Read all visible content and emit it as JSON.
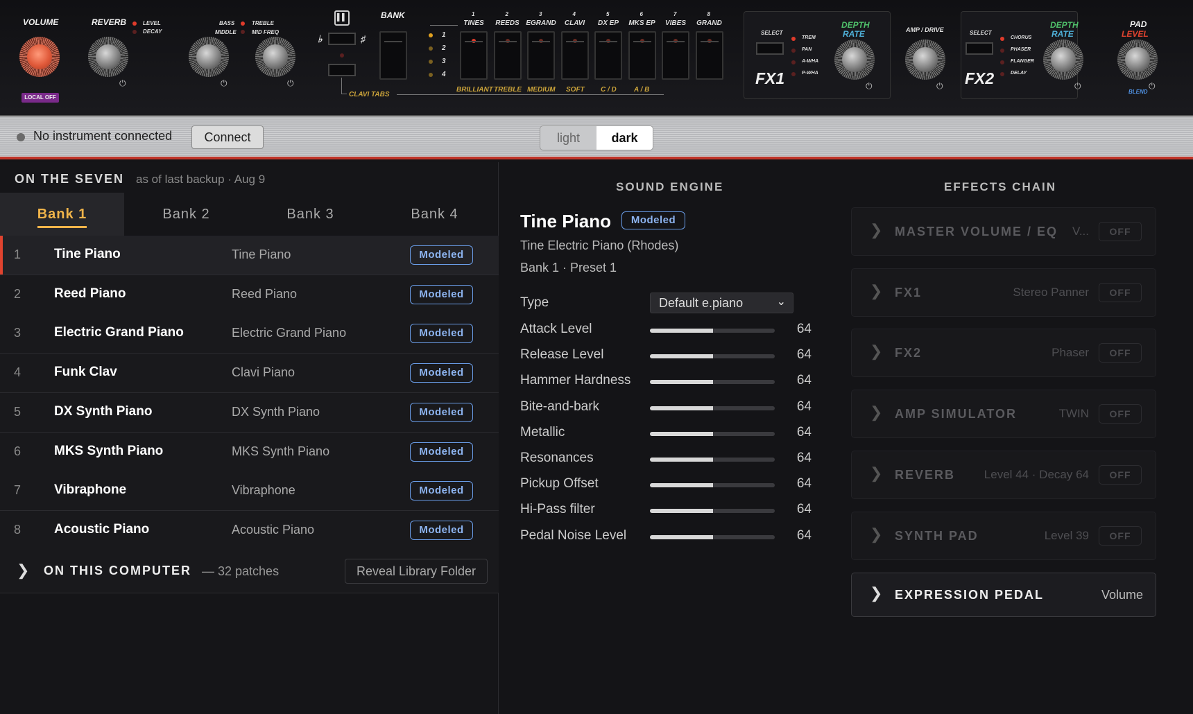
{
  "hardware": {
    "volume": "VOLUME",
    "local_off": "LOCAL OFF",
    "reverb": "REVERB",
    "reverb_level": "LEVEL",
    "reverb_decay": "DECAY",
    "bass": "BASS",
    "middle": "MIDDLE",
    "treble": "TREBLE",
    "mid_freq": "MID FREQ",
    "flat": "♭",
    "sharp": "♯",
    "bank": "BANK",
    "bank_numbers": [
      "1",
      "2",
      "3",
      "4"
    ],
    "clavi_tabs": "CLAVI TABS",
    "sound_slots": [
      {
        "num": "1",
        "label": "TINES"
      },
      {
        "num": "2",
        "label": "REEDS"
      },
      {
        "num": "3",
        "label": "EGRAND"
      },
      {
        "num": "4",
        "label": "CLAVI"
      },
      {
        "num": "5",
        "label": "DX EP"
      },
      {
        "num": "6",
        "label": "MKS EP"
      },
      {
        "num": "7",
        "label": "VIBES"
      },
      {
        "num": "8",
        "label": "GRAND"
      }
    ],
    "clavi_labels": [
      "BRILLIANT",
      "TREBLE",
      "MEDIUM",
      "SOFT",
      "C / D",
      "A / B"
    ],
    "fx1": "FX1",
    "fx1_select": "SELECT",
    "fx1_options": [
      "TREM",
      "PAN",
      "A-WHA",
      "P-WHA"
    ],
    "depth": "DEPTH",
    "rate": "RATE",
    "amp_drive": "AMP / DRIVE",
    "fx2": "FX2",
    "fx2_select": "SELECT",
    "fx2_options": [
      "CHORUS",
      "PHASER",
      "FLANGER",
      "DELAY"
    ],
    "pad": "PAD",
    "level": "LEVEL",
    "blend": "BLEND",
    "power_glyph": "⏻",
    "pause_glyph": "▌▌"
  },
  "connection": {
    "status": "No instrument connected",
    "connect_label": "Connect",
    "theme_light": "light",
    "theme_dark": "dark"
  },
  "left": {
    "header": "ON THE SEVEN",
    "subheader": "as of last backup · Aug 9",
    "tabs": [
      "Bank 1",
      "Bank 2",
      "Bank 3",
      "Bank 4"
    ],
    "presets": [
      {
        "num": "1",
        "name": "Tine Piano",
        "instrument": "Tine Piano",
        "badge": "Modeled"
      },
      {
        "num": "2",
        "name": "Reed Piano",
        "instrument": "Reed Piano",
        "badge": "Modeled"
      },
      {
        "num": "3",
        "name": "Electric Grand Piano",
        "instrument": "Electric Grand Piano",
        "badge": "Modeled"
      },
      {
        "num": "4",
        "name": "Funk Clav",
        "instrument": "Clavi Piano",
        "badge": "Modeled"
      },
      {
        "num": "5",
        "name": "DX Synth Piano",
        "instrument": "DX Synth Piano",
        "badge": "Modeled"
      },
      {
        "num": "6",
        "name": "MKS Synth Piano",
        "instrument": "MKS Synth Piano",
        "badge": "Modeled"
      },
      {
        "num": "7",
        "name": "Vibraphone",
        "instrument": "Vibraphone",
        "badge": "Modeled"
      },
      {
        "num": "8",
        "name": "Acoustic Piano",
        "instrument": "Acoustic Piano",
        "badge": "Modeled"
      }
    ],
    "computer_title": "ON THIS COMPUTER",
    "computer_count": "— 32 patches",
    "reveal_label": "Reveal Library Folder"
  },
  "engine": {
    "header": "SOUND ENGINE",
    "title": "Tine Piano",
    "badge": "Modeled",
    "description": "Tine Electric Piano (Rhodes)",
    "location": "Bank 1 · Preset 1",
    "type_label": "Type",
    "type_value": "Default e.piano",
    "params": [
      {
        "label": "Attack Level",
        "value": "64",
        "fraction": 0.504
      },
      {
        "label": "Release Level",
        "value": "64",
        "fraction": 0.504
      },
      {
        "label": "Hammer Hardness",
        "value": "64",
        "fraction": 0.504
      },
      {
        "label": "Bite-and-bark",
        "value": "64",
        "fraction": 0.504
      },
      {
        "label": "Metallic",
        "value": "64",
        "fraction": 0.504
      },
      {
        "label": "Resonances",
        "value": "64",
        "fraction": 0.504
      },
      {
        "label": "Pickup Offset",
        "value": "64",
        "fraction": 0.504
      },
      {
        "label": "Hi-Pass filter",
        "value": "64",
        "fraction": 0.504
      },
      {
        "label": "Pedal Noise Level",
        "value": "64",
        "fraction": 0.504
      }
    ]
  },
  "effects": {
    "header": "EFFECTS CHAIN",
    "items": [
      {
        "name": "MASTER VOLUME / EQ",
        "detail": "V...",
        "state": "OFF"
      },
      {
        "name": "FX1",
        "detail": "Stereo Panner",
        "state": "OFF"
      },
      {
        "name": "FX2",
        "detail": "Phaser",
        "state": "OFF"
      },
      {
        "name": "AMP SIMULATOR",
        "detail": "TWIN",
        "state": "OFF"
      },
      {
        "name": "REVERB",
        "detail": "Level 44 · Decay 64",
        "state": "OFF"
      },
      {
        "name": "SYNTH PAD",
        "detail": "Level 39",
        "state": "OFF"
      }
    ],
    "pedal": {
      "name": "EXPRESSION PEDAL",
      "detail": "Volume"
    }
  },
  "colors": {
    "accent": "#f0b44a",
    "badge": "#6a9de8",
    "led": "#e03b2b",
    "bar_border": "#c0352a"
  },
  "icons": {
    "chevron": "chevron-right-icon",
    "dropdown": "chevron-down-icon",
    "power": "power-icon"
  }
}
